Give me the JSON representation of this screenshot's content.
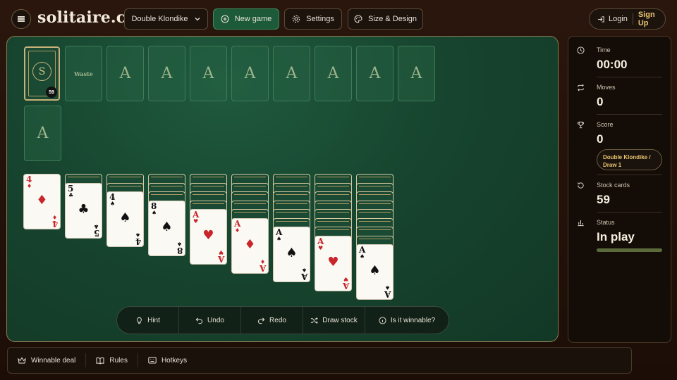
{
  "app": {
    "brand": "solitaire.cx"
  },
  "header": {
    "game_select": "Double Klondike",
    "new_game_label": "New game",
    "settings_label": "Settings",
    "design_label": "Size & Design",
    "login_label": "Login",
    "signup_label": "Sign Up"
  },
  "board": {
    "stock_count": "59",
    "waste_label": "Waste",
    "foundation_label": "A",
    "foundations": 8,
    "extra_foundation_label": "A",
    "stock_brand": "S"
  },
  "tableau": [
    {
      "face_down": 0,
      "rank": "4",
      "suit": "♦",
      "color": "red"
    },
    {
      "face_down": 1,
      "rank": "5",
      "suit": "♣",
      "color": "black"
    },
    {
      "face_down": 2,
      "rank": "4",
      "suit": "♠",
      "color": "black"
    },
    {
      "face_down": 3,
      "rank": "8",
      "suit": "♠",
      "color": "black"
    },
    {
      "face_down": 4,
      "rank": "A",
      "suit": "♥",
      "color": "red"
    },
    {
      "face_down": 5,
      "rank": "A",
      "suit": "♦",
      "color": "red"
    },
    {
      "face_down": 6,
      "rank": "A",
      "suit": "♠",
      "color": "black"
    },
    {
      "face_down": 7,
      "rank": "A",
      "suit": "♥",
      "color": "red"
    },
    {
      "face_down": 8,
      "rank": "A",
      "suit": "♠",
      "color": "black"
    }
  ],
  "actions": {
    "hint": "Hint",
    "undo": "Undo",
    "redo": "Redo",
    "draw": "Draw stock",
    "winnable": "Is it winnable?"
  },
  "sidebar": {
    "time_label": "Time",
    "time_value": "00:00",
    "moves_label": "Moves",
    "moves_value": "0",
    "score_label": "Score",
    "score_value": "0",
    "mode_pill": "Double Klondike / Draw 1",
    "stock_label": "Stock cards",
    "stock_value": "59",
    "status_label": "Status",
    "status_value": "In play",
    "status_progress": 1.0
  },
  "footer": {
    "winnable_deal": "Winnable deal",
    "rules": "Rules",
    "hotkeys": "Hotkeys"
  },
  "colors": {
    "felt": "#17452f",
    "accent_green": "#1c5a3a",
    "gold": "#e8c570",
    "card_red": "#c8262a"
  }
}
